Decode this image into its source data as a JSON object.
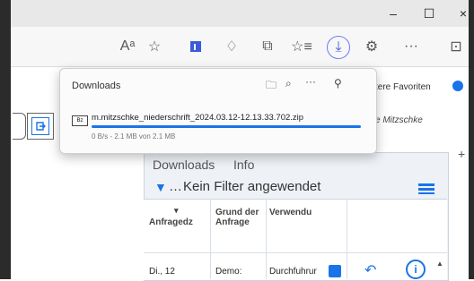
{
  "window": {
    "buttons": {
      "minimize": "–",
      "maximize": "☐",
      "close": "×"
    }
  },
  "toolbar": {
    "read_aloud": "Aᵃ",
    "favorites_star": "☆",
    "collections": "⌂",
    "extensions": "♢",
    "split_screen": "⧉",
    "favorites": "☆≡",
    "downloads": "⤓",
    "copilot": "⚙",
    "more": "···",
    "new_tab": "⊡"
  },
  "favorites_bar": {
    "other_favorites": "tere Favoriten"
  },
  "page": {
    "person": "e Mitzschke",
    "panel_tabs": [
      "Downloads",
      "Info"
    ],
    "filter_text": "Kein Filter angewendet",
    "headers": {
      "col1": "Anfragedz",
      "col2": "Grund der Anfrage",
      "col3": "Verwendu"
    },
    "row": {
      "col1": "Di., 12",
      "col2": "Demo:",
      "col3": "Durchfuhrur"
    }
  },
  "downloads_popup": {
    "title": "Downloads",
    "file_name": "m.mitzschke_niederschrift_2024.03.12-12.13.33.702.zip",
    "meta": "0 B/s - 2.1 MB von 2.1 MB",
    "file_badge": "Bz",
    "progress": 1.0
  }
}
